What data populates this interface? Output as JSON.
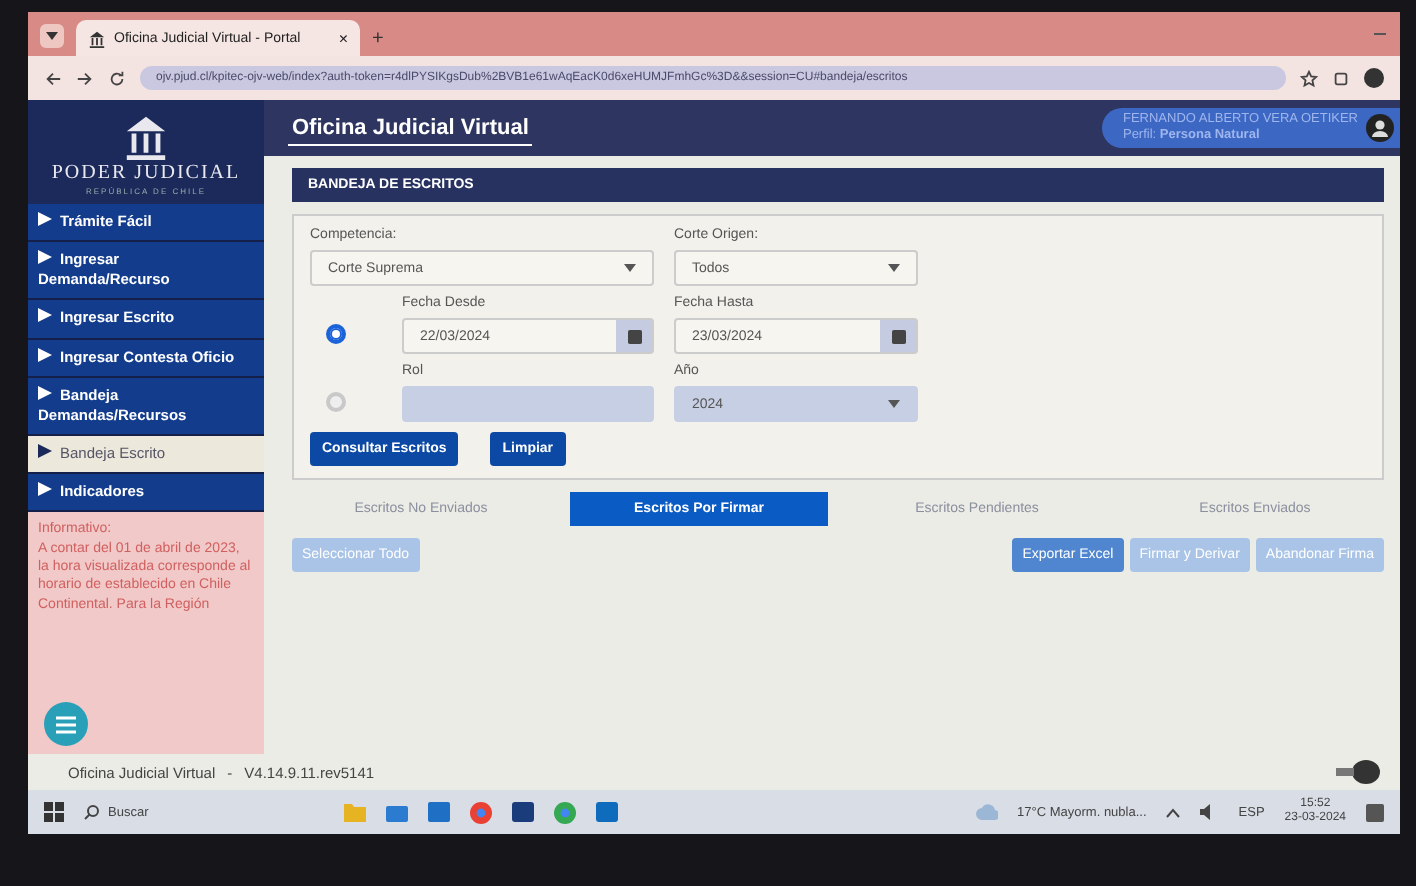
{
  "browser": {
    "tab_title": "Oficina Judicial Virtual - Portal",
    "tab_close": "×",
    "new_tab": "+",
    "url": "ojv.pjud.cl/kpitec-ojv-web/index?auth-token=r4dlPYSIKgsDub%2BVB1e61wAqEacK0d6xeHUMJFmhGc%3D&&session=CU#bandeja/escritos"
  },
  "header": {
    "title": "Oficina Judicial Virtual",
    "user_name": "FERNANDO ALBERTO VERA OETIKER",
    "profile": "Perfil: **Persona Natural**"
  },
  "sidebar": {
    "logo_text": "PODER JUDICIAL",
    "logo_subtext": "REPÚBLICA DE CHILE",
    "items": [
      {
        "label": "Trámite Fácil",
        "selected": false
      },
      {
        "label": "Ingresar Demanda/Recurso",
        "selected": false
      },
      {
        "label": "Ingresar Escrito",
        "selected": false
      },
      {
        "label": "Ingresar Contesta Oficio",
        "selected": false
      },
      {
        "label": "Bandeja Demandas/Recursos",
        "selected": false
      },
      {
        "label": "Bandeja Escrito",
        "selected": true
      },
      {
        "label": "Indicadores",
        "selected": false
      }
    ],
    "info_title": "Informativo:",
    "info_text": "A contar del 01 de abril de 2023, la hora visualizada corresponde al horario de establecido en Chile Continental. Para la Región"
  },
  "panel": {
    "title": "BANDEJA DE ESCRITOS",
    "competencia": {
      "label": "Competencia:",
      "value": "Corte Suprema"
    },
    "corte_origen": {
      "label": "Corte Origen:",
      "value": "Todos"
    },
    "search_by_date": {
      "selected": true,
      "from_label": "Fecha Desde",
      "from_value": "22/03/2024",
      "to_label": "Fecha Hasta",
      "to_value": "23/03/2024"
    },
    "search_by_rol": {
      "selected": false,
      "rol_label": "Rol",
      "year_label": "Año",
      "year_value": "2024"
    },
    "buttons": [
      "Consultar Escritos",
      "Limpiar"
    ]
  },
  "tabs": [
    {
      "label": "Escritos No Enviados",
      "selected": false
    },
    {
      "label": "Escritos Por Firmar",
      "selected": true
    },
    {
      "label": "Escritos Pendientes",
      "selected": false
    },
    {
      "label": "Escritos Enviados",
      "selected": false
    }
  ],
  "select_all": {
    "label": "Seleccionar Todo",
    "disabled": true
  },
  "actions": [
    {
      "label": "Exportar Excel",
      "disabled": false
    },
    {
      "label": "Firmar y Derivar",
      "disabled": true
    },
    {
      "label": "Abandonar Firma",
      "disabled": true
    }
  ],
  "footer": {
    "app": "Oficina Judicial Virtual",
    "separator": "-",
    "version": "V4.14.9.11.rev5141"
  },
  "taskbar": {
    "search": "Buscar",
    "weather": "17°C Mayorm. nubla...",
    "language": "ESP",
    "time": "15:52",
    "date": "23-03-2024"
  }
}
